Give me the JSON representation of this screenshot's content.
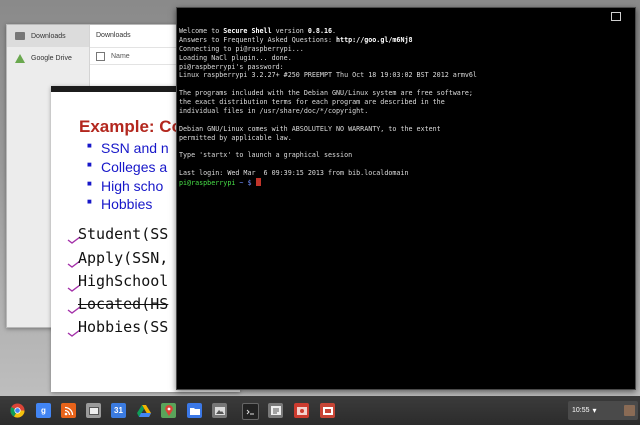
{
  "files": {
    "sidebar": [
      {
        "label": "Downloads",
        "icon": "downloads-icon",
        "selected": true
      },
      {
        "label": "Google Drive",
        "icon": "google-drive-icon",
        "selected": false
      }
    ],
    "main_title": "Downloads",
    "column_name": "Name"
  },
  "slide": {
    "title": "Example: Co",
    "bullets": [
      "SSN and n",
      "Colleges a",
      "High scho",
      "Hobbies"
    ],
    "relations": [
      {
        "text": "Student(SS",
        "struck": false
      },
      {
        "text": "Apply(SSN,",
        "struck": false
      },
      {
        "text": "HighSchool",
        "struck": false
      },
      {
        "text": "Located(HS",
        "struck": true
      },
      {
        "text": "Hobbies(SS",
        "struck": false
      }
    ]
  },
  "terminal": {
    "welcome_pre": "Welcome to ",
    "app_name": "Secure Shell",
    "welcome_mid": " version ",
    "version": "0.8.16",
    "welcome_end": ".",
    "faq_pre": "Answers to Frequently Asked Questions: ",
    "faq_url": "http://goo.gl/m6Nj8",
    "lines": [
      "Connecting to pi@raspberrypi...",
      "Loading NaCl plugin... done.",
      "pi@raspberrypi's password:",
      "Linux raspberrypi 3.2.27+ #250 PREEMPT Thu Oct 18 19:03:02 BST 2012 armv6l",
      "",
      "The programs included with the Debian GNU/Linux system are free software;",
      "the exact distribution terms for each program are described in the",
      "individual files in /usr/share/doc/*/copyright.",
      "",
      "Debian GNU/Linux comes with ABSOLUTELY NO WARRANTY, to the extent",
      "permitted by applicable law.",
      "",
      "Type 'startx' to launch a graphical session",
      "",
      "Last login: Wed Mar  6 09:39:15 2013 from bib.localdomain"
    ],
    "prompt_user": "pi@raspberrypi",
    "prompt_path": " ~ $ "
  },
  "shelf": {
    "apps": [
      {
        "name": "chrome-icon",
        "color": "#dd4b39"
      },
      {
        "name": "google-search-icon",
        "color": "#4285f4",
        "glyph": "g"
      },
      {
        "name": "rss-icon",
        "color": "#e8631a"
      },
      {
        "name": "window-icon",
        "color": "#9a9a9a"
      },
      {
        "name": "calendar-icon",
        "color": "#3b7be0",
        "glyph": "31"
      },
      {
        "name": "drive-icon",
        "color": "#f4b400"
      },
      {
        "name": "maps-icon",
        "color": "#5aa45a"
      },
      {
        "name": "files-icon",
        "color": "#3b78e7"
      },
      {
        "name": "gallery-icon",
        "color": "#777777"
      },
      {
        "name": "terminal-icon",
        "color": "#222222"
      },
      {
        "name": "docs-icon",
        "color": "#7a7a7a"
      },
      {
        "name": "photos-icon",
        "color": "#cc3b2f"
      },
      {
        "name": "presentation-icon",
        "color": "#c74536"
      }
    ],
    "time": "10:55"
  }
}
